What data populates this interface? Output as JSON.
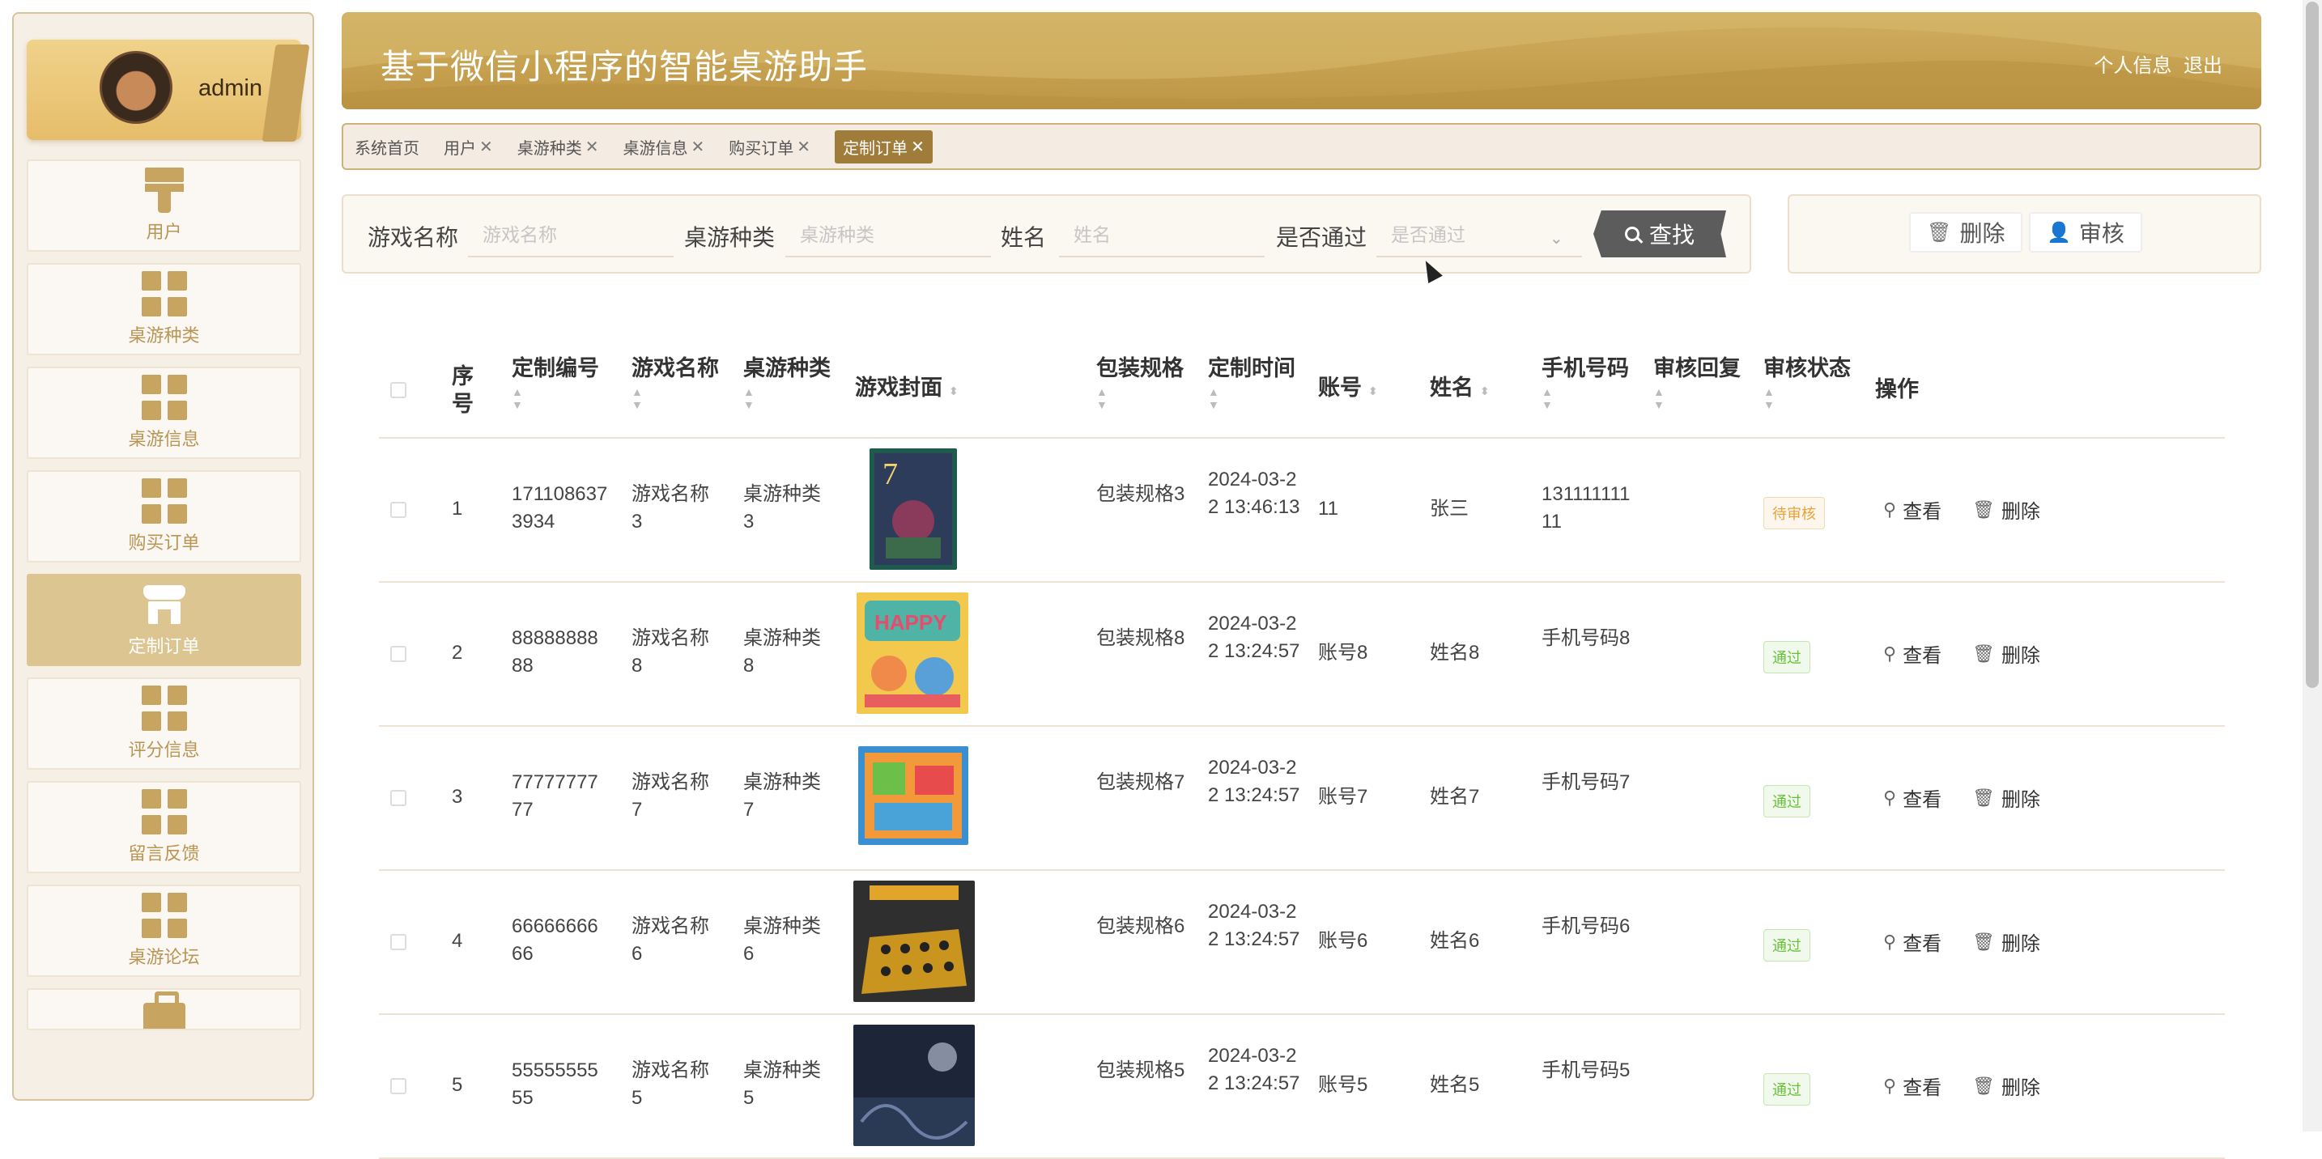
{
  "header": {
    "title": "基于微信小程序的智能桌游助手",
    "profile_link": "个人信息",
    "logout_link": "退出"
  },
  "colors": {
    "brand": "#c6a14f",
    "sidebar_active": "#dcc590",
    "tag_active": "#a07c3a"
  },
  "sidebar": {
    "user": {
      "name": "admin"
    },
    "items": [
      {
        "label": "用户",
        "icon": "paint-brush-icon",
        "active": false
      },
      {
        "label": "桌游种类",
        "icon": "grid-icon",
        "active": false
      },
      {
        "label": "桌游信息",
        "icon": "grid-icon",
        "active": false
      },
      {
        "label": "购买订单",
        "icon": "grid-icon",
        "active": false
      },
      {
        "label": "定制订单",
        "icon": "shop-icon",
        "active": true
      },
      {
        "label": "评分信息",
        "icon": "grid-icon",
        "active": false
      },
      {
        "label": "留言反馈",
        "icon": "grid-icon",
        "active": false
      },
      {
        "label": "桌游论坛",
        "icon": "grid-icon",
        "active": false
      },
      {
        "label": "",
        "icon": "briefcase-icon",
        "active": false
      }
    ]
  },
  "tags": [
    {
      "label": "系统首页",
      "closable": false
    },
    {
      "label": "用户",
      "closable": true
    },
    {
      "label": "桌游种类",
      "closable": true
    },
    {
      "label": "桌游信息",
      "closable": true
    },
    {
      "label": "购买订单",
      "closable": true
    },
    {
      "label": "定制订单",
      "closable": true,
      "active": true
    }
  ],
  "tag_close_glyph": "✕",
  "search": {
    "game_name_label": "游戏名称",
    "game_name_placeholder": "游戏名称",
    "category_label": "桌游种类",
    "category_placeholder": "桌游种类",
    "name_label": "姓名",
    "name_placeholder": "姓名",
    "approved_label": "是否通过",
    "approved_placeholder": "是否通过",
    "search_button": "查找"
  },
  "actions": {
    "delete_button": "删除",
    "review_button": "审核"
  },
  "table": {
    "headers": {
      "index": "序号",
      "order_no": "定制编号",
      "game_name": "游戏名称",
      "category": "桌游种类",
      "cover": "游戏封面",
      "package": "包装规格",
      "time": "定制时间",
      "account": "账号",
      "name": "姓名",
      "phone": "手机号码",
      "reply": "审核回复",
      "status": "审核状态",
      "ops": "操作"
    },
    "view_label": "查看",
    "delete_label": "删除",
    "rows": [
      {
        "index": "1",
        "order_no": "1711086373934",
        "game_name": "游戏名称3",
        "category": "桌游种类3",
        "package": "包装规格3",
        "time": "2024-03-22 13:46:13",
        "account": "11",
        "name": "张三",
        "phone": "13111111111",
        "reply": "",
        "status": "待审核",
        "status_type": "pending"
      },
      {
        "index": "2",
        "order_no": "8888888888",
        "game_name": "游戏名称8",
        "category": "桌游种类8",
        "package": "包装规格8",
        "time": "2024-03-22 13:24:57",
        "account": "账号8",
        "name": "姓名8",
        "phone": "手机号码8",
        "reply": "",
        "status": "通过",
        "status_type": "pass"
      },
      {
        "index": "3",
        "order_no": "7777777777",
        "game_name": "游戏名称7",
        "category": "桌游种类7",
        "package": "包装规格7",
        "time": "2024-03-22 13:24:57",
        "account": "账号7",
        "name": "姓名7",
        "phone": "手机号码7",
        "reply": "",
        "status": "通过",
        "status_type": "pass"
      },
      {
        "index": "4",
        "order_no": "6666666666",
        "game_name": "游戏名称6",
        "category": "桌游种类6",
        "package": "包装规格6",
        "time": "2024-03-22 13:24:57",
        "account": "账号6",
        "name": "姓名6",
        "phone": "手机号码6",
        "reply": "",
        "status": "通过",
        "status_type": "pass"
      },
      {
        "index": "5",
        "order_no": "5555555555",
        "game_name": "游戏名称5",
        "category": "桌游种类5",
        "package": "包装规格5",
        "time": "2024-03-22 13:24:57",
        "account": "账号5",
        "name": "姓名5",
        "phone": "手机号码5",
        "reply": "",
        "status": "通过",
        "status_type": "pass"
      }
    ]
  }
}
